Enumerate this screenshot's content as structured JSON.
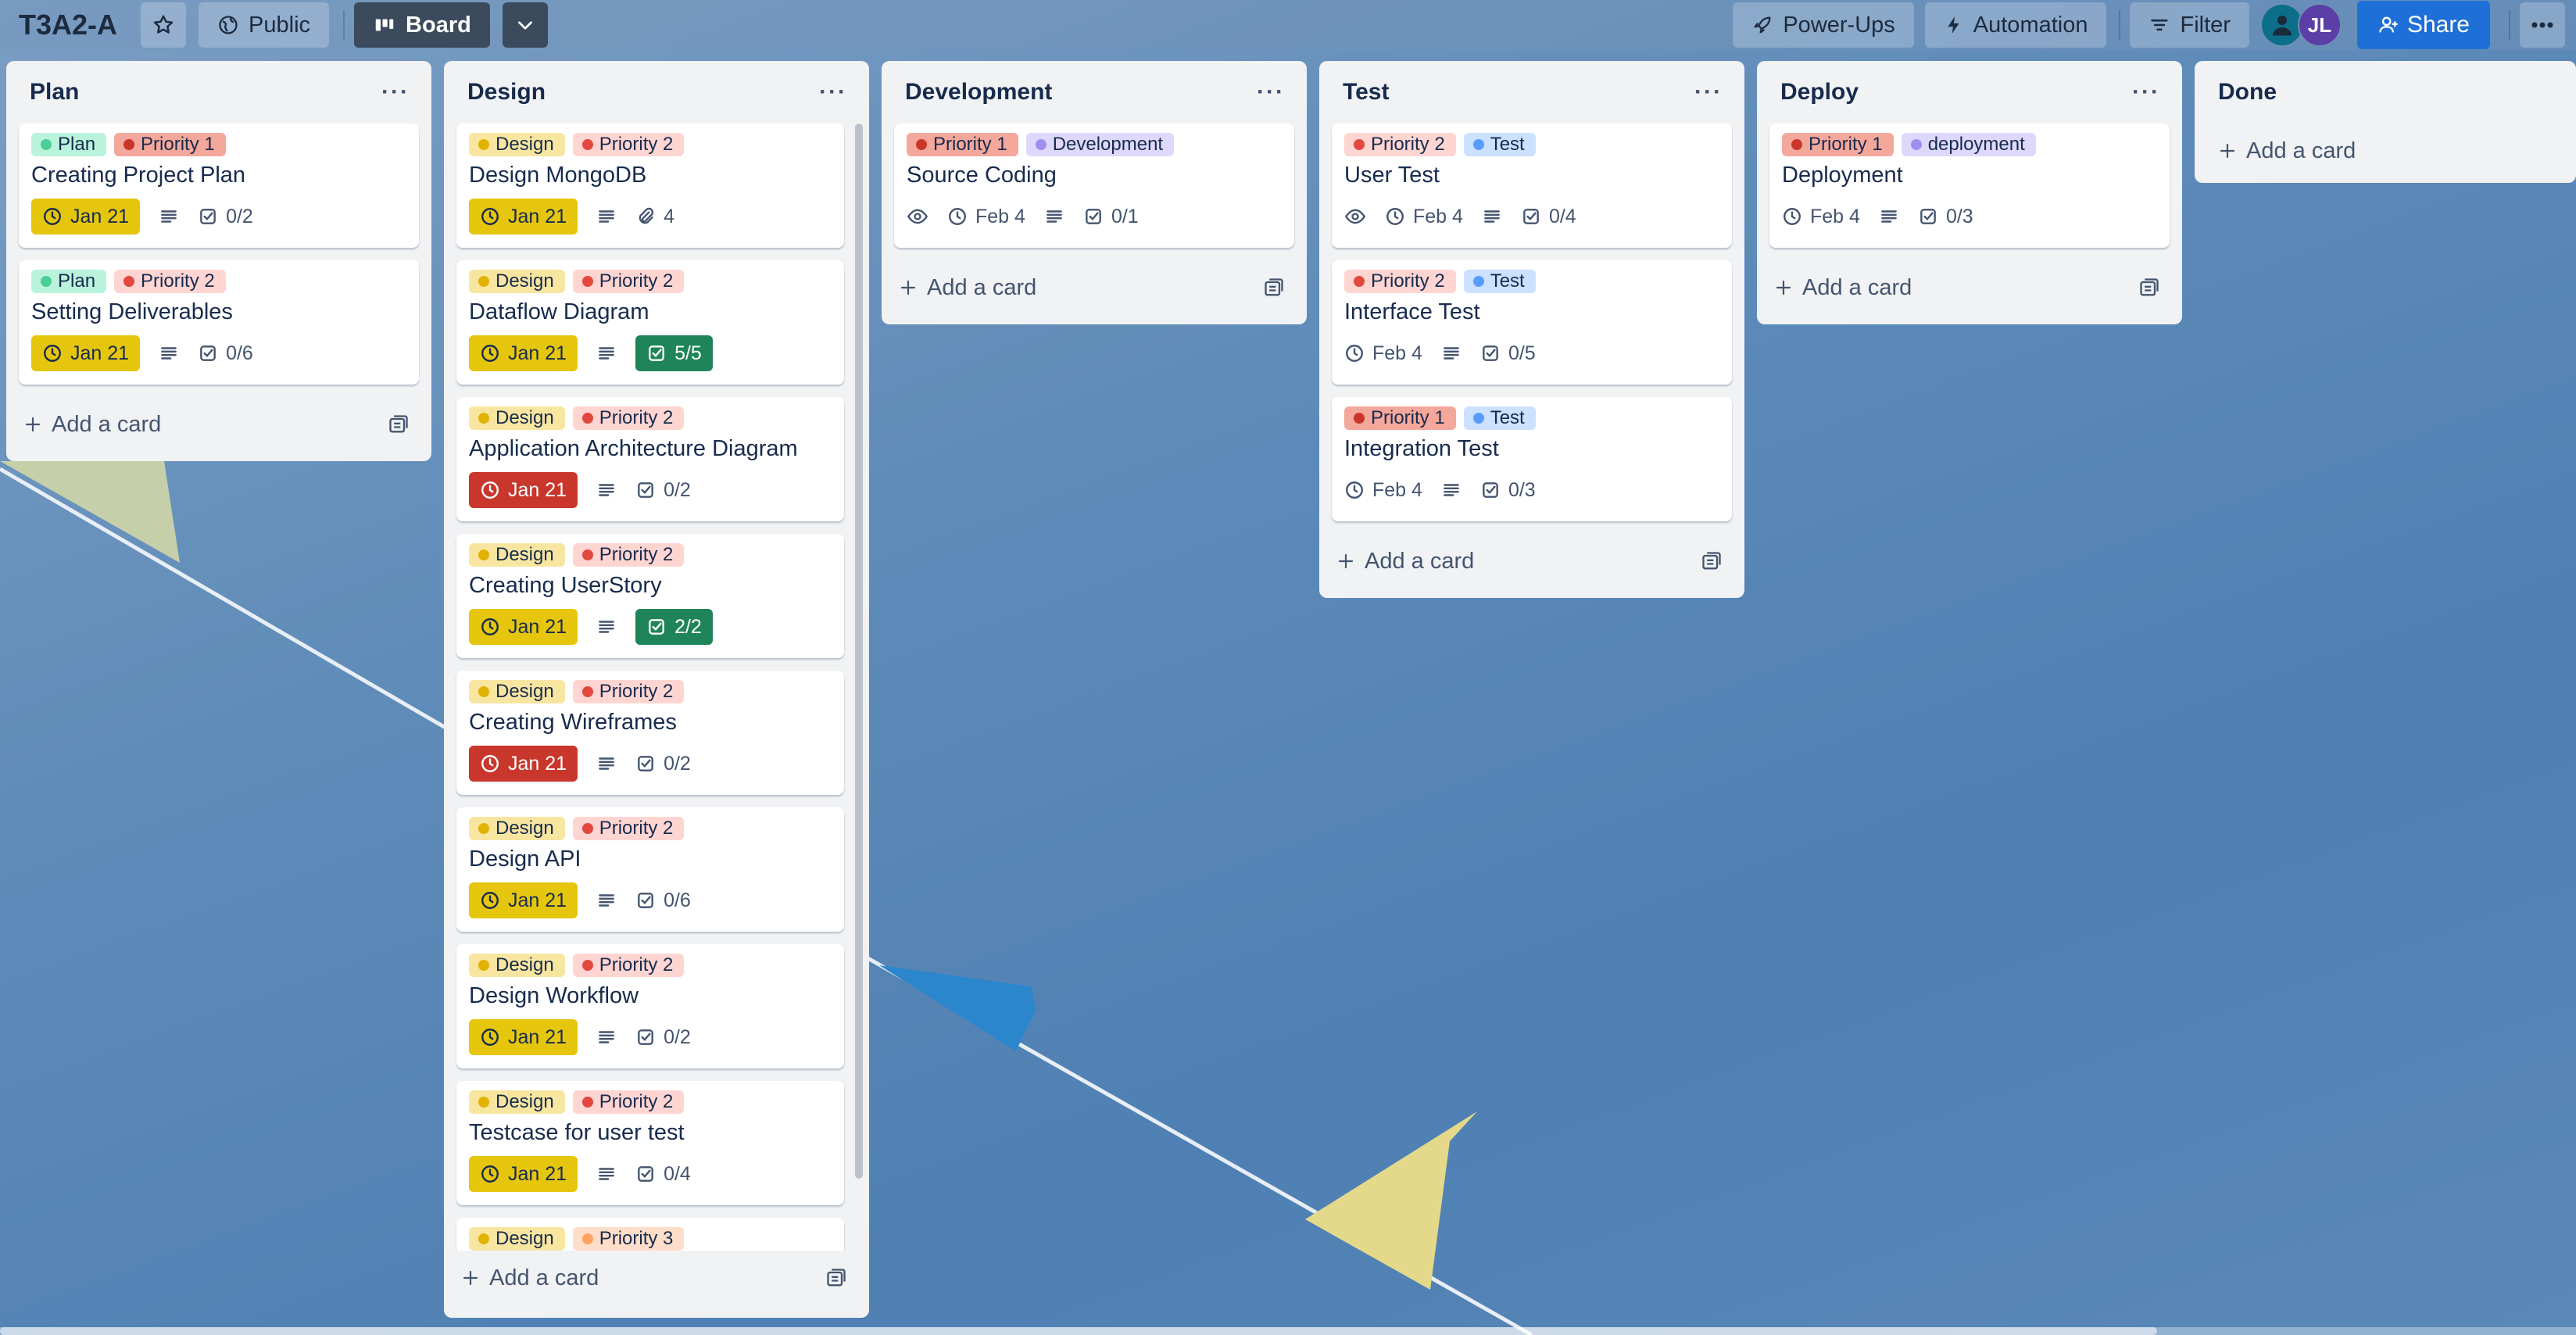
{
  "colors": {
    "date_yellow": "#e6c60d",
    "date_red": "#c9372c",
    "checklist_complete": "#1f845a",
    "share_blue": "#1f6fd8",
    "label_plan_bg": "#baf3db",
    "label_plan_dot": "#4bce97",
    "label_priority1_bg": "#f4a79b",
    "label_priority1_dot": "#c9372c",
    "label_priority2_bg": "#ffd5d2",
    "label_priority2_dot": "#e2483d",
    "label_priority3_bg": "#fedec8",
    "label_priority3_dot": "#fea362",
    "label_design_bg": "#f8e6a0",
    "label_design_dot": "#e2b203",
    "label_development_bg": "#dfd8fd",
    "label_development_dot": "#9f8fef",
    "label_test_bg": "#cce0ff",
    "label_test_dot": "#579dff",
    "label_deployment_bg": "#dfd8fd",
    "label_deployment_dot": "#9f8fef"
  },
  "header": {
    "board_title": "T3A2-A",
    "star_icon": "star-icon",
    "visibility_label": "Public",
    "view_label": "Board",
    "power_ups_label": "Power-Ups",
    "automation_label": "Automation",
    "filter_label": "Filter",
    "avatar_initials": "JL",
    "share_label": "Share",
    "more_icon": "ellipsis-icon"
  },
  "add_card_label": "Add a card",
  "lists": {
    "plan": {
      "title": "Plan",
      "cards": [
        {
          "labels": [
            "Plan",
            "Priority 1"
          ],
          "title": "Creating Project Plan",
          "date": "Jan 21",
          "checklist": "0/2"
        },
        {
          "labels": [
            "Plan",
            "Priority 2"
          ],
          "title": "Setting Deliverables",
          "date": "Jan 21",
          "checklist": "0/6"
        }
      ]
    },
    "design": {
      "title": "Design",
      "cards": [
        {
          "labels": [
            "Design",
            "Priority 2"
          ],
          "title": "Design MongoDB",
          "date": "Jan 21",
          "attachments": "4"
        },
        {
          "labels": [
            "Design",
            "Priority 2"
          ],
          "title": "Dataflow Diagram",
          "date": "Jan 21",
          "checklist": "5/5"
        },
        {
          "labels": [
            "Design",
            "Priority 2"
          ],
          "title": "Application Architecture Diagram",
          "date": "Jan 21",
          "checklist": "0/2"
        },
        {
          "labels": [
            "Design",
            "Priority 2"
          ],
          "title": "Creating UserStory",
          "date": "Jan 21",
          "checklist": "2/2"
        },
        {
          "labels": [
            "Design",
            "Priority 2"
          ],
          "title": "Creating Wireframes",
          "date": "Jan 21",
          "checklist": "0/2"
        },
        {
          "labels": [
            "Design",
            "Priority 2"
          ],
          "title": "Design API",
          "date": "Jan 21",
          "checklist": "0/6"
        },
        {
          "labels": [
            "Design",
            "Priority 2"
          ],
          "title": "Design Workflow",
          "date": "Jan 21",
          "checklist": "0/2"
        },
        {
          "labels": [
            "Design",
            "Priority 2"
          ],
          "title": "Testcase for user test",
          "date": "Jan 21",
          "checklist": "0/4"
        },
        {
          "labels": [
            "Design",
            "Priority 3"
          ]
        }
      ]
    },
    "development": {
      "title": "Development",
      "cards": [
        {
          "labels": [
            "Priority 1",
            "Development"
          ],
          "title": "Source Coding",
          "date": "Feb 4",
          "checklist": "0/1"
        }
      ]
    },
    "test": {
      "title": "Test",
      "cards": [
        {
          "labels": [
            "Priority 2",
            "Test"
          ],
          "title": "User Test",
          "date": "Feb 4",
          "checklist": "0/4"
        },
        {
          "labels": [
            "Priority 2",
            "Test"
          ],
          "title": "Interface Test",
          "date": "Feb 4",
          "checklist": "0/5"
        },
        {
          "labels": [
            "Priority 1",
            "Test"
          ],
          "title": "Integration Test",
          "date": "Feb 4",
          "checklist": "0/3"
        }
      ]
    },
    "deploy": {
      "title": "Deploy",
      "cards": [
        {
          "labels": [
            "Priority 1",
            "deployment"
          ],
          "title": "Deployment",
          "date": "Feb 4",
          "checklist": "0/3"
        }
      ]
    },
    "done": {
      "title": "Done"
    }
  }
}
